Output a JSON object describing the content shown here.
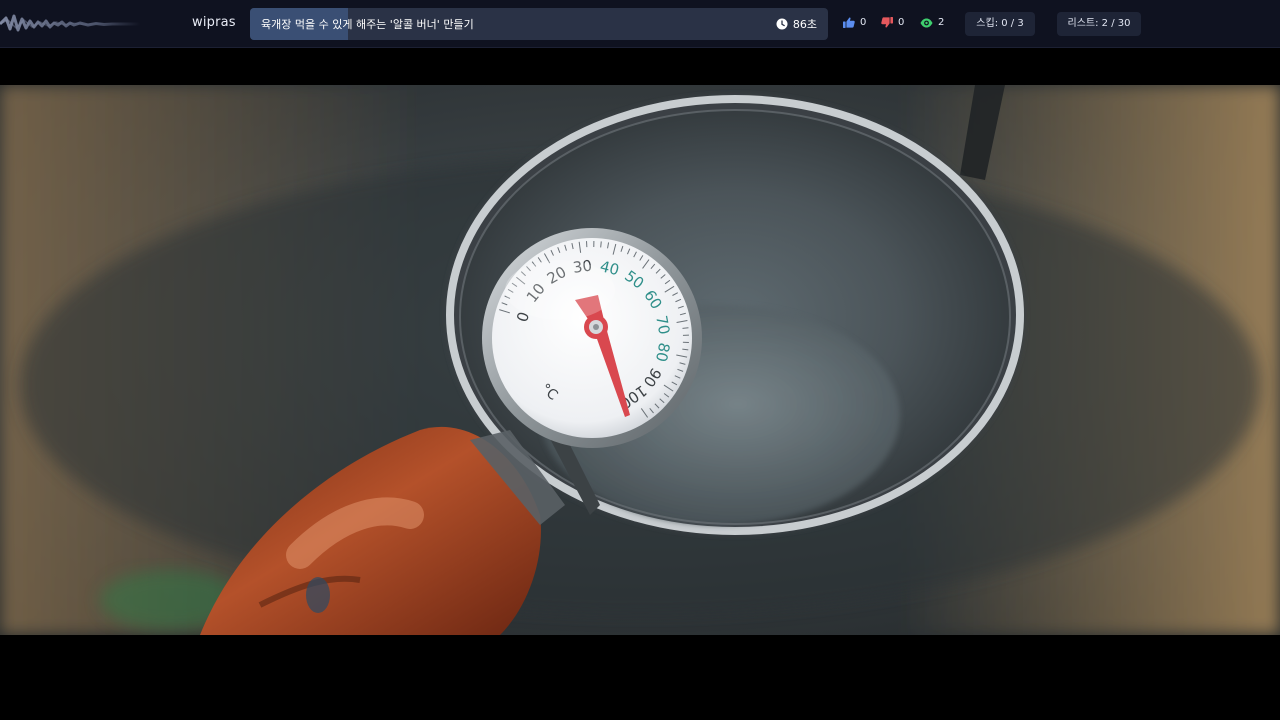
{
  "header": {
    "username": "wipras",
    "video_title": "육개장 먹을 수 있게 해주는 '알콜 버너' 만들기",
    "timer": "86초",
    "likes": "0",
    "dislikes": "0",
    "views": "2",
    "skip_counter": "스킵: 0 / 3",
    "list_counter": "리스트: 2 / 30",
    "title_progress": 0.17
  },
  "video": {
    "thermometer_scale_unit": "°C",
    "thermometer_labels": [
      "0",
      "10",
      "20",
      "30",
      "40",
      "50",
      "60",
      "70",
      "80",
      "90",
      "100"
    ]
  },
  "colors": {
    "topbar_bg": "#0f1220",
    "title_box": "#2a3246",
    "title_progress": "#3a4f74",
    "like_icon": "#5b8def",
    "dislike_icon": "#e5585d",
    "view_icon": "#3ecf6e",
    "needle": "#d9484f"
  },
  "icons": {
    "timer": "clock-icon",
    "likes": "thumbs-up-icon",
    "dislikes": "thumbs-down-icon",
    "views": "eye-icon"
  }
}
